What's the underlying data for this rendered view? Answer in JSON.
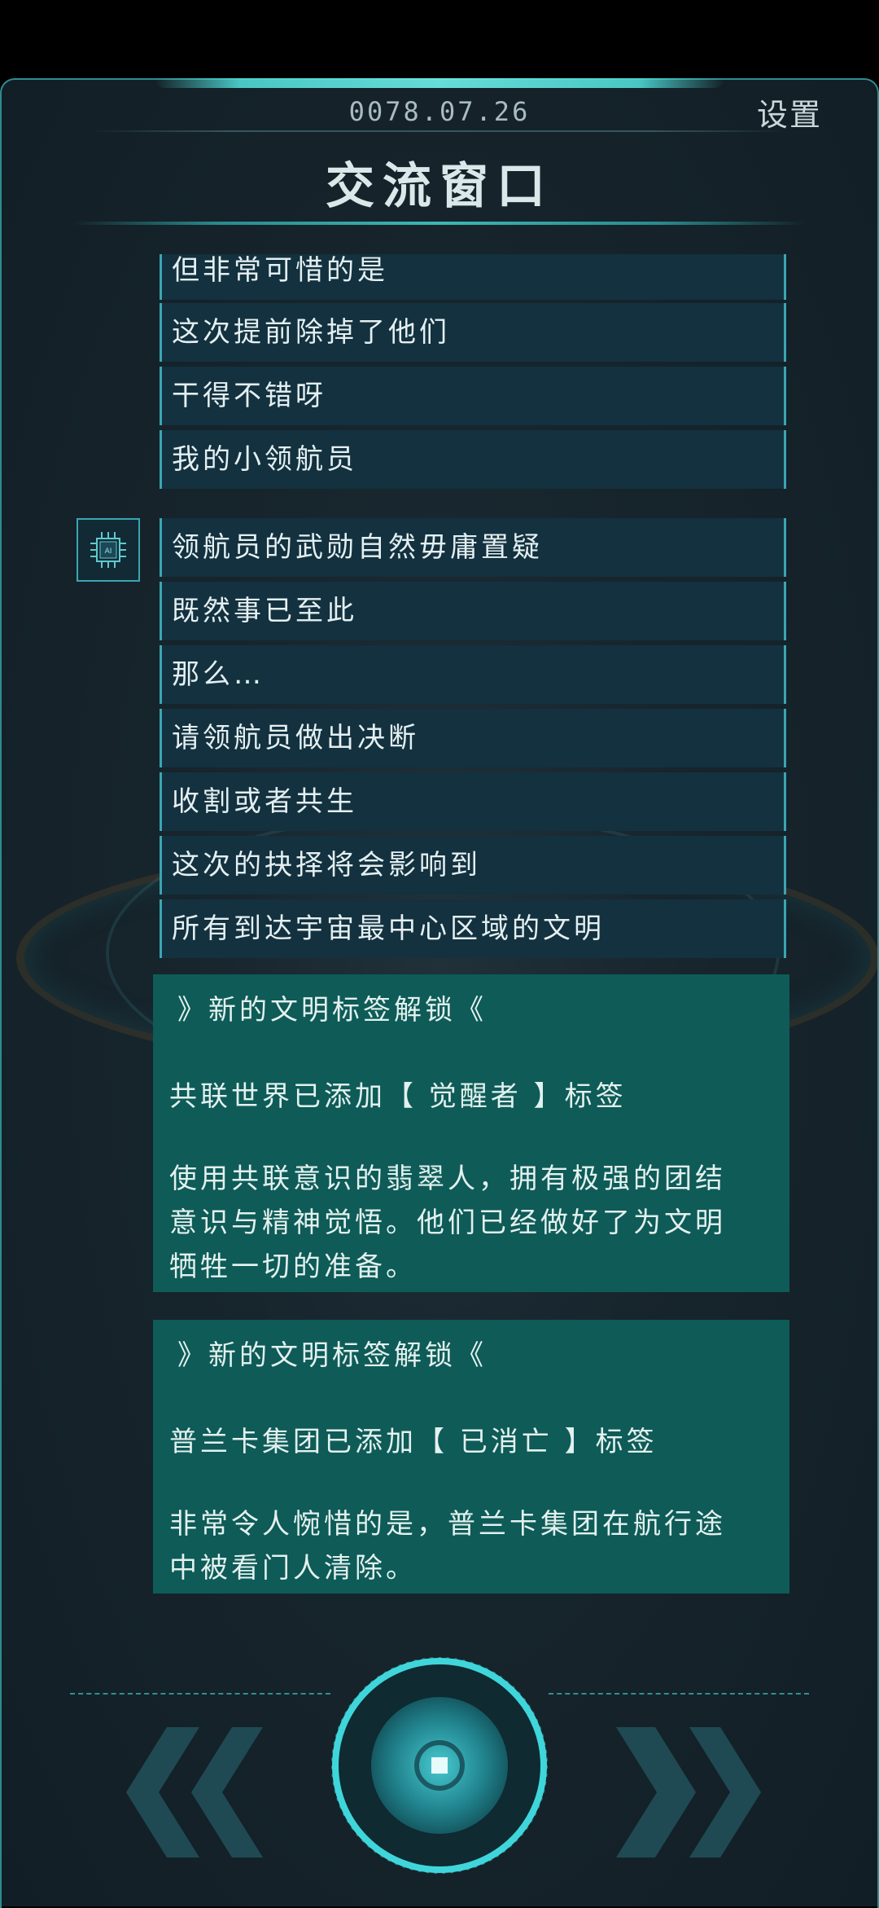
{
  "header": {
    "date": "0078.07.26",
    "settings_label": "设置",
    "title": "交流窗口"
  },
  "messages_top": [
    "但非常可惜的是",
    "这次提前除掉了他们",
    "干得不错呀",
    "我的小领航员"
  ],
  "ai_avatar": {
    "label": "AI",
    "icon": "chip-icon"
  },
  "messages_ai": [
    "领航员的武勋自然毋庸置疑",
    "既然事已至此",
    "那么…",
    "请领航员做出决断",
    "收割或者共生",
    "这次的抉择将会影响到",
    "所有到达宇宙最中心区域的文明"
  ],
  "notices": [
    {
      "header": "》新的文明标签解锁《",
      "line": "共联世界已添加【 觉醒者 】标签",
      "body": [
        "使用共联意识的翡翠人，拥有极强的团结",
        "意识与精神觉悟。他们已经做好了为文明",
        "牺牲一切的准备。"
      ]
    },
    {
      "header": "》新的文明标签解锁《",
      "line": "普兰卡集团已添加【 已消亡 】标签",
      "body": [
        "非常令人惋惜的是，普兰卡集团在航行途",
        "中被看门人清除。"
      ]
    }
  ],
  "controls": {
    "back_icon": "double-chevron-left-icon",
    "center_icon": "record-icon",
    "forward_icon": "double-chevron-right-icon"
  },
  "colors": {
    "accent": "#3aa6b3",
    "message_bg": "#13313f",
    "notice_bg": "#0e5b58",
    "background": "#17252d"
  }
}
